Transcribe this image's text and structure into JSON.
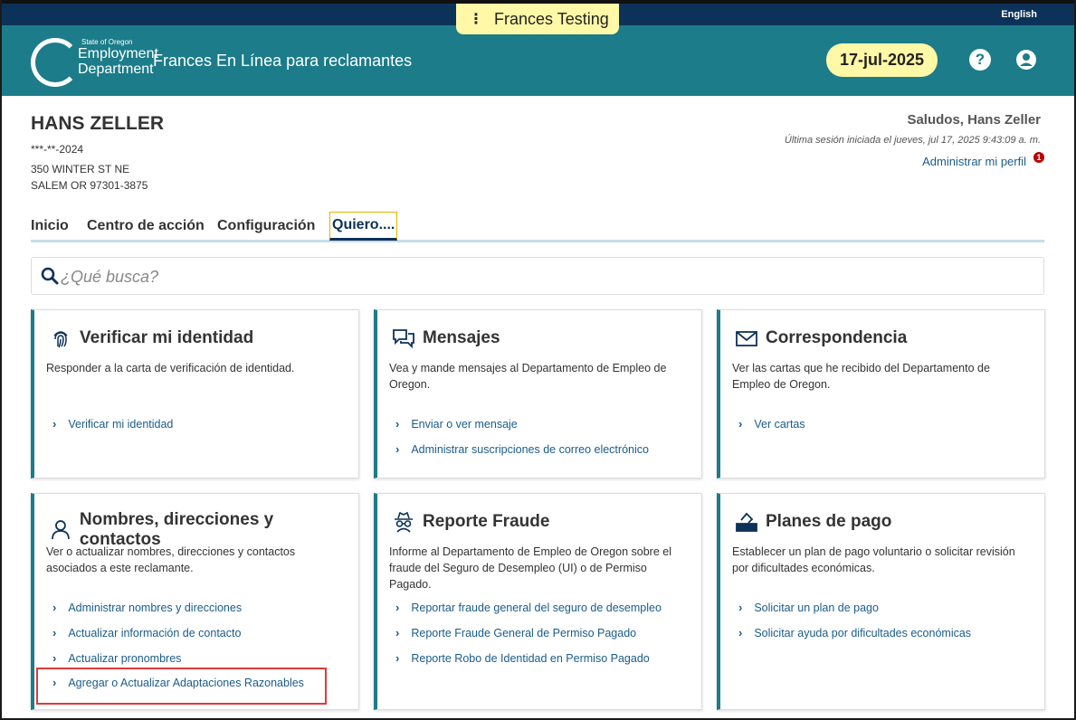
{
  "topbar": {
    "language_link": "English",
    "testing_badge": "Frances Testing"
  },
  "header": {
    "logo_small": "State of Oregon",
    "logo_line1": "Employment",
    "logo_line2": "Department",
    "app_title": "Frances En Línea para reclamantes",
    "date": "17-jul-2025"
  },
  "claimant": {
    "name": "HANS ZELLER",
    "ssn": "***-**-2024",
    "address_line1": "350 WINTER ST NE",
    "address_line2": "SALEM OR 97301-3875"
  },
  "session": {
    "greeting": "Saludos, Hans Zeller",
    "last_login": "Última sesión iniciada el jueves, jul 17, 2025 9:43:09 a. m.",
    "profile_link": "Administrar mi perfil",
    "profile_badge": "1"
  },
  "tabs": [
    {
      "label": "Inicio"
    },
    {
      "label": "Centro de acción"
    },
    {
      "label": "Configuración"
    },
    {
      "label": "Quiero...."
    }
  ],
  "search": {
    "placeholder": "¿Qué busca?"
  },
  "cards": [
    {
      "title": "Verificar mi identidad",
      "icon": "fingerprint-icon",
      "description": "Responder a la carta de verificación de identidad.",
      "links": [
        "Verificar mi identidad"
      ]
    },
    {
      "title": "Mensajes",
      "icon": "chat-icon",
      "description": "Vea y mande mensajes al Departamento de Empleo de Oregon.",
      "links": [
        "Enviar o ver mensaje",
        "Administrar suscripciones de correo electrónico"
      ]
    },
    {
      "title": "Correspondencia",
      "icon": "envelope-icon",
      "description": "Ver las cartas que he recibido del Departamento de Empleo de Oregon.",
      "links": [
        "Ver cartas"
      ]
    },
    {
      "title": "Nombres, direcciones y contactos",
      "icon": "person-icon",
      "description": "Ver o actualizar nombres, direcciones y contactos asociados a este reclamante.",
      "links": [
        "Administrar nombres y direcciones",
        "Actualizar información de contacto",
        "Actualizar pronombres",
        "Agregar o Actualizar Adaptaciones Razonables"
      ]
    },
    {
      "title": "Reporte Fraude",
      "icon": "spy-icon",
      "description": "Informe al Departamento de Empleo de Oregon sobre el fraude del Seguro de Desempleo (UI) o de Permiso Pagado.",
      "links": [
        "Reportar fraude general del seguro de desempleo",
        "Reporte Fraude General de Permiso Pagado",
        "Reporte Robo de Identidad en Permiso Pagado"
      ]
    },
    {
      "title": "Planes de pago",
      "icon": "ballot-box-icon",
      "description": "Establecer un plan de pago voluntario o solicitar revisión por dificultades económicas.",
      "links": [
        "Solicitar un plan de pago",
        "Solicitar ayuda por dificultades económicas"
      ]
    }
  ],
  "colors": {
    "header": "#1c7c89",
    "topstrip": "#0c3259",
    "badge": "#fff8a6",
    "link": "#1a5c8a",
    "highlight": "#e03a3a"
  }
}
